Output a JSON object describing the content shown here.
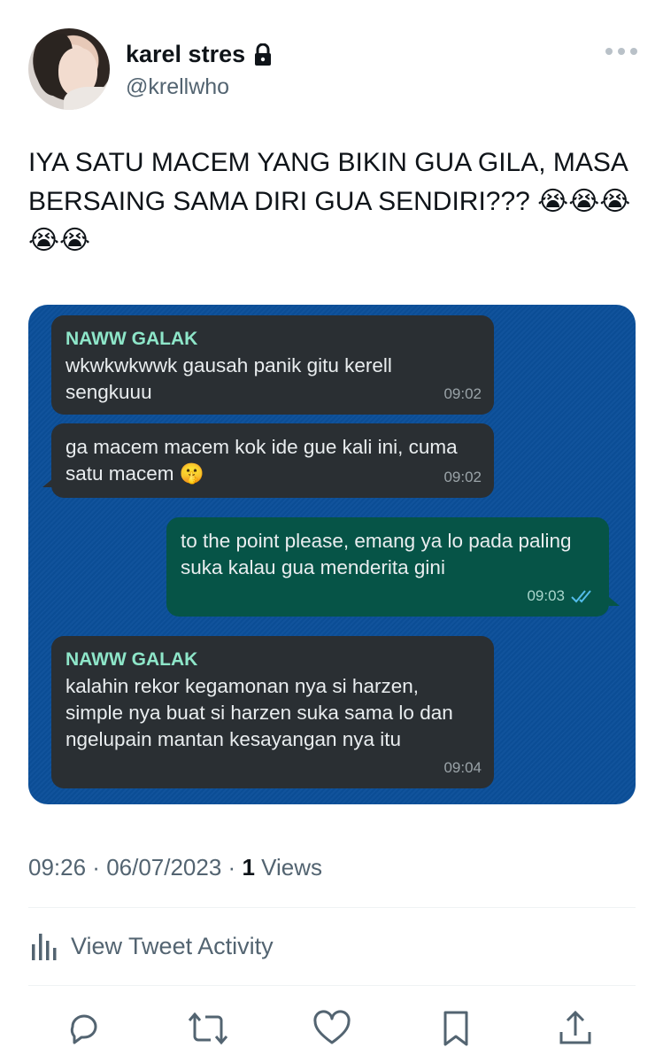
{
  "user": {
    "display_name": "karel stres",
    "handle": "@krellwho",
    "locked": true
  },
  "tweet": {
    "text": "IYA SATU MACEM YANG BIKIN GUA GILA, MASA BERSAING SAMA DIRI GUA SENDIRI??? 😭😭😭😭😭"
  },
  "chat": {
    "messages": [
      {
        "direction": "in",
        "sender": "NAWW GALAK",
        "text": "wkwkwkwwk gausah panik gitu kerell sengkuuu",
        "time": "09:02"
      },
      {
        "direction": "in",
        "sender": "",
        "text": "ga macem macem kok ide gue kali ini, cuma satu macem 🤫",
        "time": "09:02"
      },
      {
        "direction": "out",
        "sender": "",
        "text": "to the point please, emang ya lo pada paling suka kalau gua menderita gini",
        "time": "09:03"
      },
      {
        "direction": "in",
        "sender": "NAWW GALAK",
        "text": "kalahin rekor kegamonan nya si harzen, simple nya buat si harzen suka sama lo dan ngelupain mantan kesayangan nya itu",
        "time": "09:04"
      }
    ]
  },
  "meta": {
    "time": "09:26",
    "separator": " · ",
    "date": "06/07/2023",
    "views_count": "1",
    "views_label": "Views"
  },
  "activity": {
    "label": "View Tweet Activity"
  },
  "actions": {
    "reply": "reply-icon",
    "retweet": "retweet-icon",
    "like": "like-icon",
    "bookmark": "bookmark-icon",
    "share": "share-icon"
  },
  "colors": {
    "chat_background": "#0b4f9a",
    "incoming_bubble": "#2a2f33",
    "outgoing_bubble": "#065447",
    "sender_name": "#8ee6c9",
    "read_ticks": "#53bdeb"
  }
}
